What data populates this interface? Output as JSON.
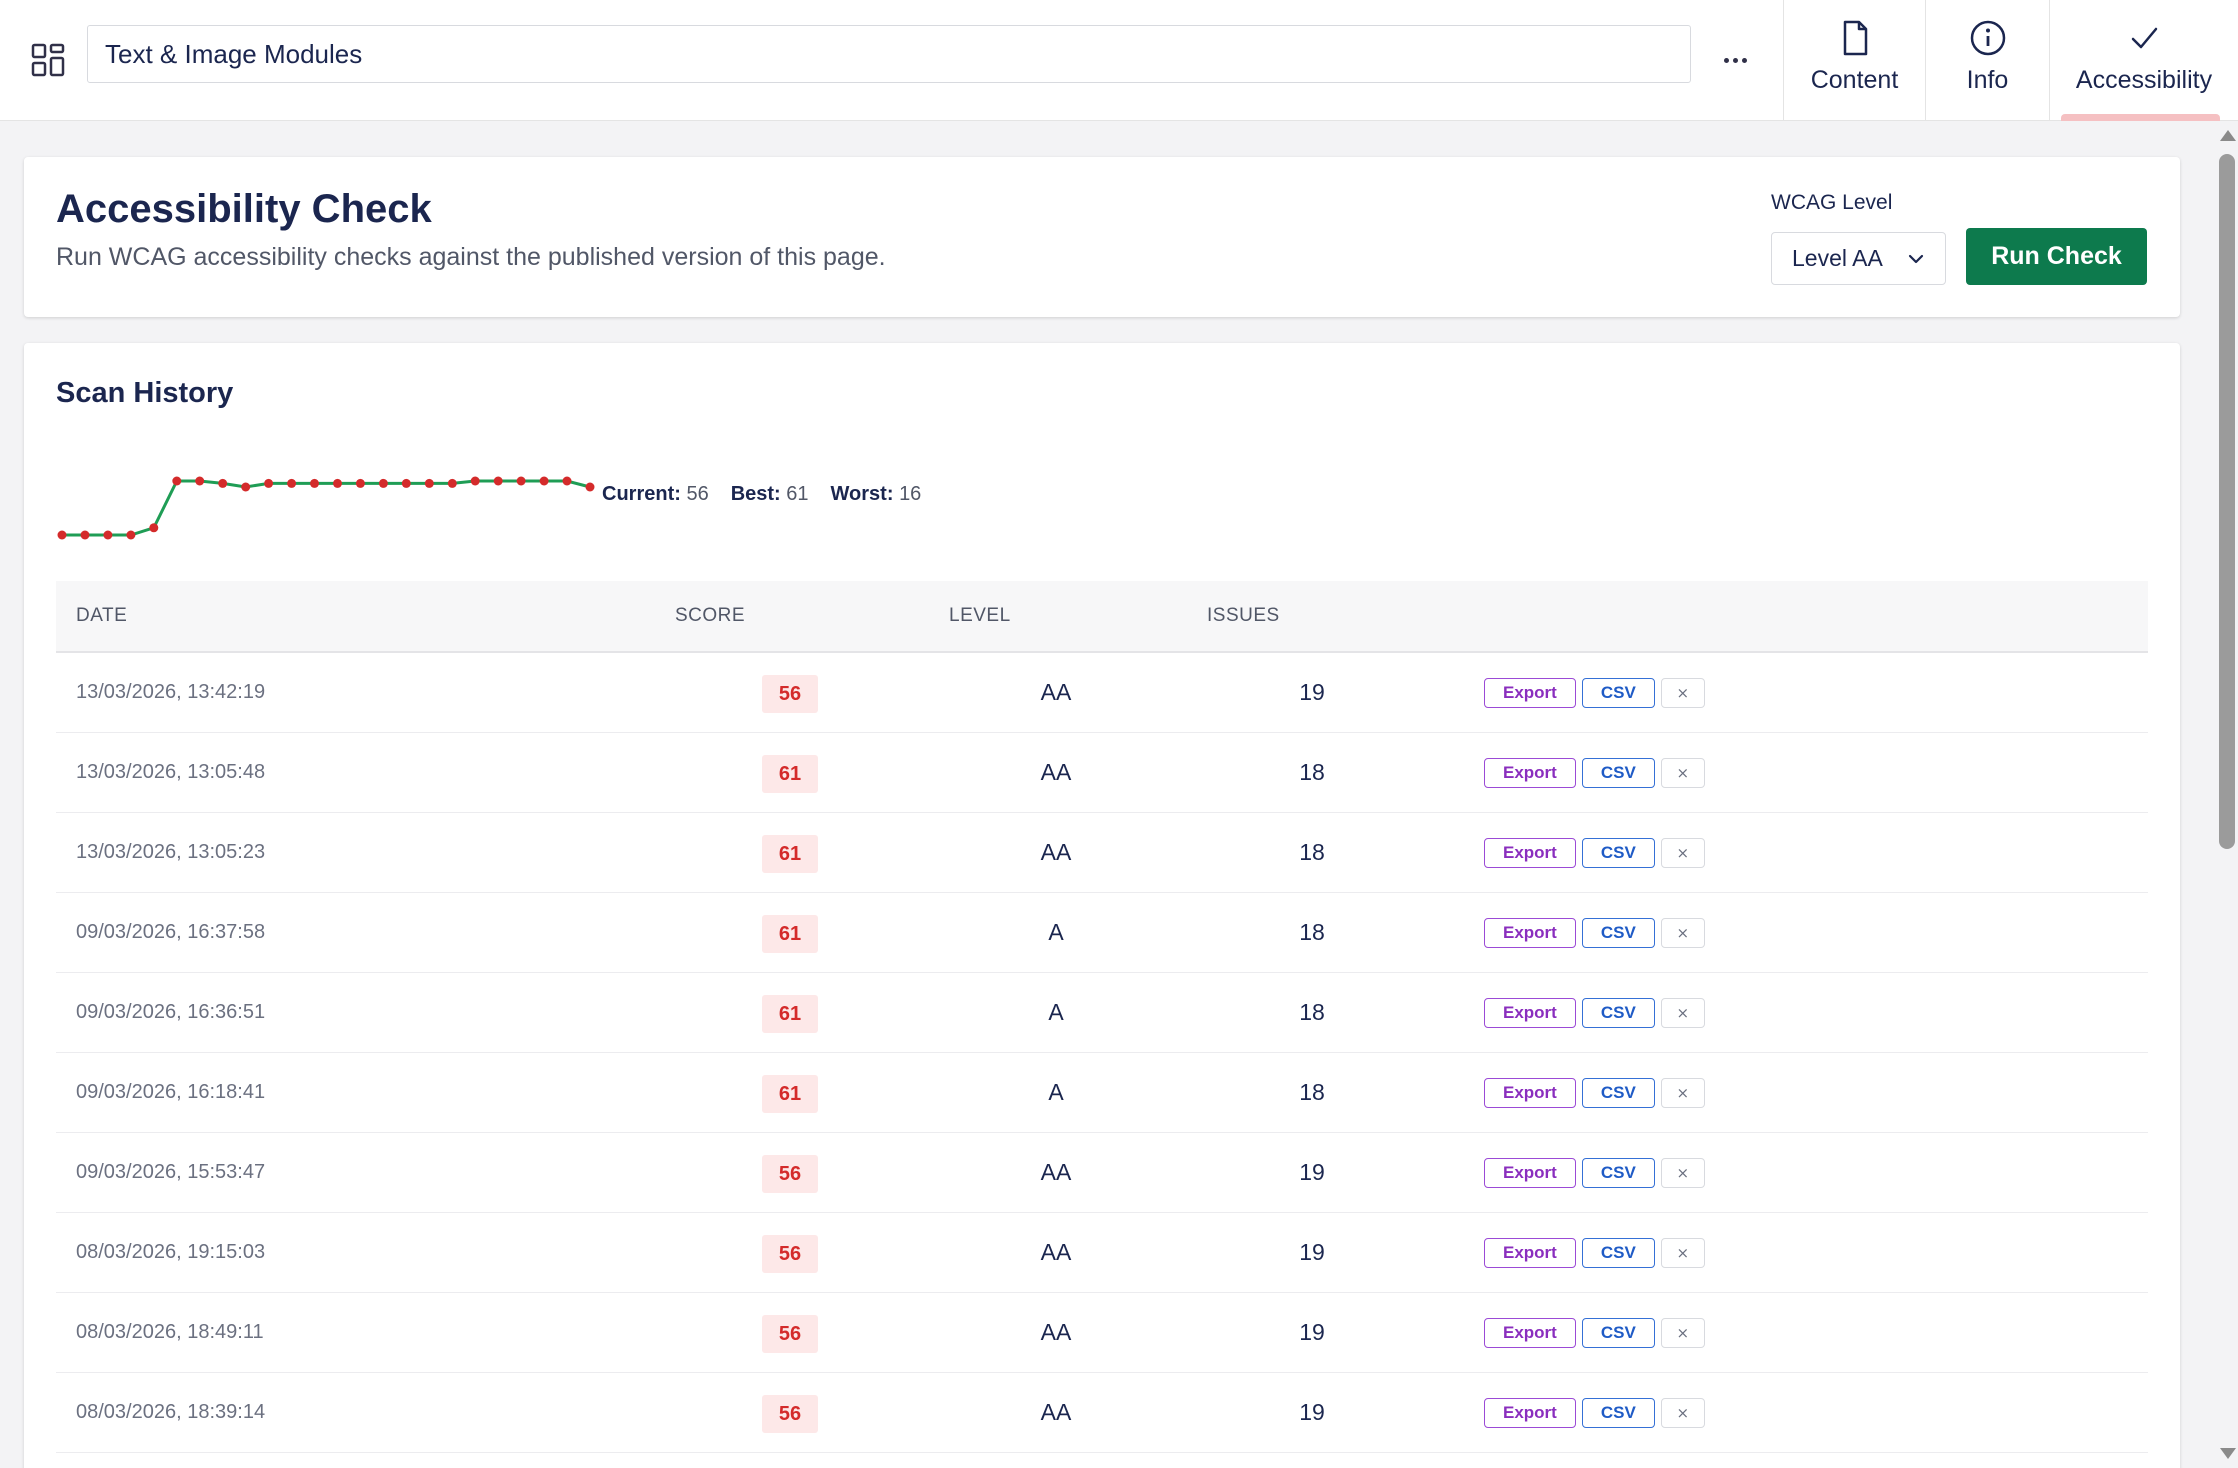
{
  "header": {
    "page_name": "Text & Image Modules",
    "tabs": [
      {
        "label": "Content",
        "icon": "document-icon"
      },
      {
        "label": "Info",
        "icon": "info-icon"
      },
      {
        "label": "Accessibility",
        "icon": "check-icon"
      }
    ],
    "active_tab": "Accessibility"
  },
  "check_card": {
    "title": "Accessibility Check",
    "description": "Run WCAG accessibility checks against the published version of this page.",
    "wcag_label": "WCAG Level",
    "wcag_selected": "Level AA",
    "run_label": "Run Check"
  },
  "history": {
    "title": "Scan History",
    "stats": {
      "current_label": "Current:",
      "current": "56",
      "best_label": "Best:",
      "best": "61",
      "worst_label": "Worst:",
      "worst": "16"
    },
    "sparkline_scores": [
      16,
      16,
      16,
      16,
      22,
      61,
      61,
      59,
      56,
      59,
      59,
      59,
      59,
      59,
      59,
      59,
      59,
      59,
      61,
      61,
      61,
      61,
      61,
      56
    ],
    "columns": [
      "DATE",
      "SCORE",
      "LEVEL",
      "ISSUES"
    ],
    "action_labels": {
      "export": "Export",
      "csv": "CSV",
      "delete": "×"
    },
    "rows": [
      {
        "date": "13/03/2026, 13:42:19",
        "score": "56",
        "level": "AA",
        "issues": "19"
      },
      {
        "date": "13/03/2026, 13:05:48",
        "score": "61",
        "level": "AA",
        "issues": "18"
      },
      {
        "date": "13/03/2026, 13:05:23",
        "score": "61",
        "level": "AA",
        "issues": "18"
      },
      {
        "date": "09/03/2026, 16:37:58",
        "score": "61",
        "level": "A",
        "issues": "18"
      },
      {
        "date": "09/03/2026, 16:36:51",
        "score": "61",
        "level": "A",
        "issues": "18"
      },
      {
        "date": "09/03/2026, 16:18:41",
        "score": "61",
        "level": "A",
        "issues": "18"
      },
      {
        "date": "09/03/2026, 15:53:47",
        "score": "56",
        "level": "AA",
        "issues": "19"
      },
      {
        "date": "08/03/2026, 19:15:03",
        "score": "56",
        "level": "AA",
        "issues": "19"
      },
      {
        "date": "08/03/2026, 18:49:11",
        "score": "56",
        "level": "AA",
        "issues": "19"
      },
      {
        "date": "08/03/2026, 18:39:14",
        "score": "56",
        "level": "AA",
        "issues": "19"
      }
    ]
  },
  "colors": {
    "primary_button": "#0d7a4d",
    "sparkline_line": "#1f9d55",
    "sparkline_point": "#d42b2b",
    "score_badge_text": "#d42b2b",
    "score_badge_bg": "#fde8e8",
    "export_button": "#8a2ebe",
    "csv_button": "#1f5bc6"
  }
}
